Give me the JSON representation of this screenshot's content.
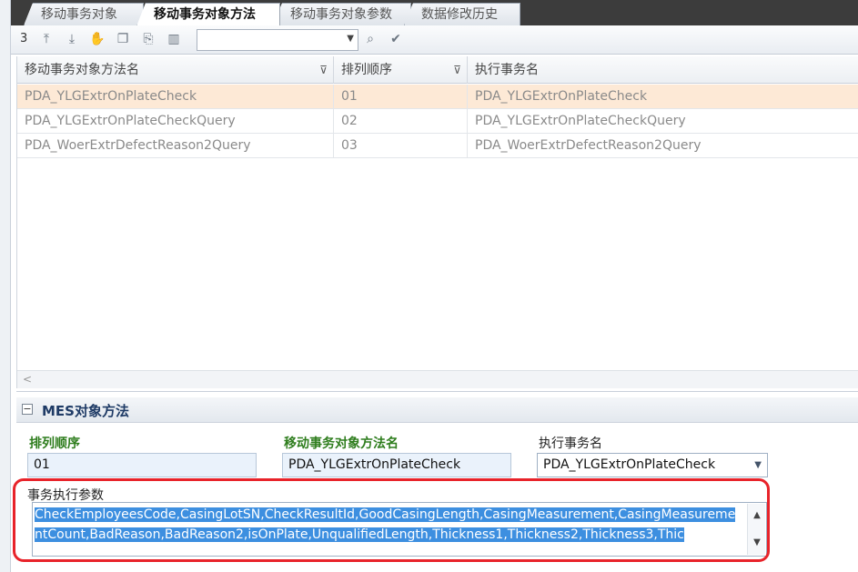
{
  "tabs": [
    {
      "label": "移动事务对象"
    },
    {
      "label": "移动事务对象方法"
    },
    {
      "label": "移动事务对象参数"
    },
    {
      "label": "数据修改历史"
    }
  ],
  "toolbar": {
    "record_count": "3",
    "icons": [
      "move-top-icon",
      "move-bottom-icon",
      "hand-icon",
      "copy-icon",
      "export-icon",
      "columns-icon",
      "search-icon",
      "check-icon"
    ],
    "select_value": ""
  },
  "grid": {
    "columns": [
      "移动事务对象方法名",
      "排列顺序",
      "执行事务名"
    ],
    "rows": [
      [
        "PDA_YLGExtrOnPlateCheck",
        "01",
        "PDA_YLGExtrOnPlateCheck"
      ],
      [
        "PDA_YLGExtrOnPlateCheckQuery",
        "02",
        "PDA_YLGExtrOnPlateCheckQuery"
      ],
      [
        "PDA_WoerExtrDefectReason2Query",
        "03",
        "PDA_WoerExtrDefectReason2Query"
      ]
    ],
    "selected_row": 0
  },
  "panel": {
    "title": "MES对象方法",
    "order_label": "排列顺序",
    "order_value": "01",
    "method_label": "移动事务对象方法名",
    "method_value": "PDA_YLGExtrOnPlateCheck",
    "exec_label": "执行事务名",
    "exec_value": "PDA_YLGExtrOnPlateCheck",
    "param_label": "事务执行参数",
    "param_value": "CheckEmployeesCode,CasingLotSN,CheckResultId,GoodCasingLength,CasingMeasurement,CasingMeasurementCount,BadReason,BadReason2,isOnPlate,UnqualifiedLength,Thickness1,Thickness2,Thickness3,Thic"
  },
  "colors": {
    "selected_row": "#fde9d6",
    "label_green": "#2e7d1d",
    "highlight_blue": "#3d8fe0",
    "annotation_red": "#e8232a"
  }
}
